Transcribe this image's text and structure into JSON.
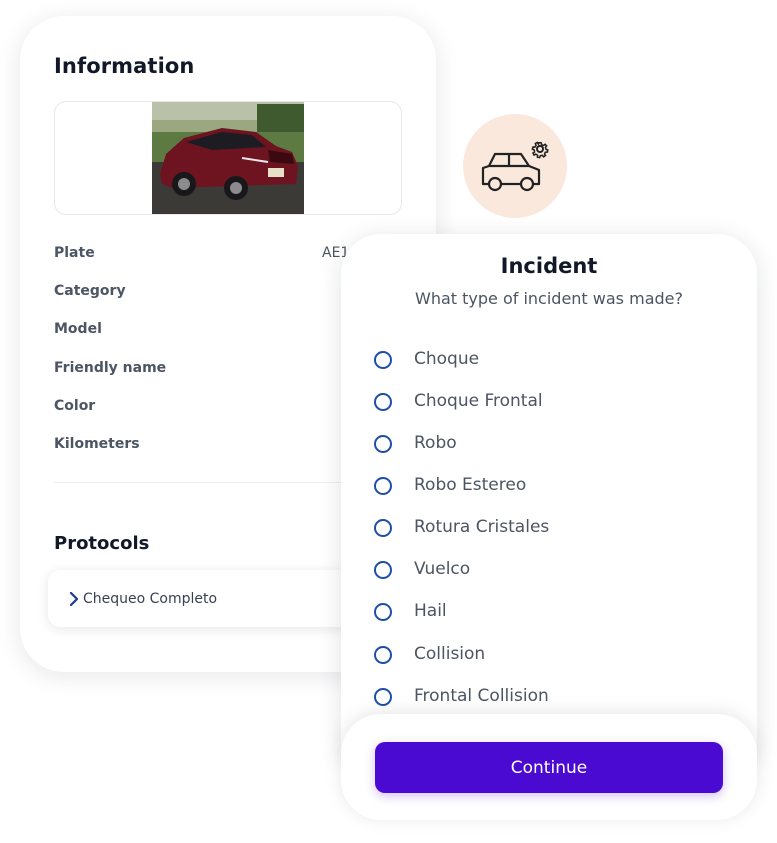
{
  "information": {
    "title": "Information",
    "attributes": [
      {
        "label": "Plate",
        "value": "AE1"
      },
      {
        "label": "Category",
        "value": ""
      },
      {
        "label": "Model",
        "value": ""
      },
      {
        "label": "Friendly name",
        "value": ""
      },
      {
        "label": "Color",
        "value": ""
      },
      {
        "label": "Kilometers",
        "value": ""
      }
    ],
    "protocols_title": "Protocols",
    "protocols": [
      {
        "label": "Chequeo Completo",
        "icon": "chevron-right-icon"
      }
    ]
  },
  "incident": {
    "icon": "car-gear-icon",
    "title": "Incident",
    "subtitle": "What type of incident was made?",
    "options": [
      {
        "label": "Choque"
      },
      {
        "label": "Choque Frontal"
      },
      {
        "label": "Robo"
      },
      {
        "label": "Robo Estereo"
      },
      {
        "label": "Rotura Cristales"
      },
      {
        "label": "Vuelco"
      },
      {
        "label": "Hail"
      },
      {
        "label": "Collision"
      },
      {
        "label": "Frontal Collision"
      }
    ],
    "continue_label": "Continue"
  },
  "colors": {
    "primary": "#4a0ad1",
    "radio": "#1e4ea8",
    "icon_bg": "#fbe8dc"
  }
}
